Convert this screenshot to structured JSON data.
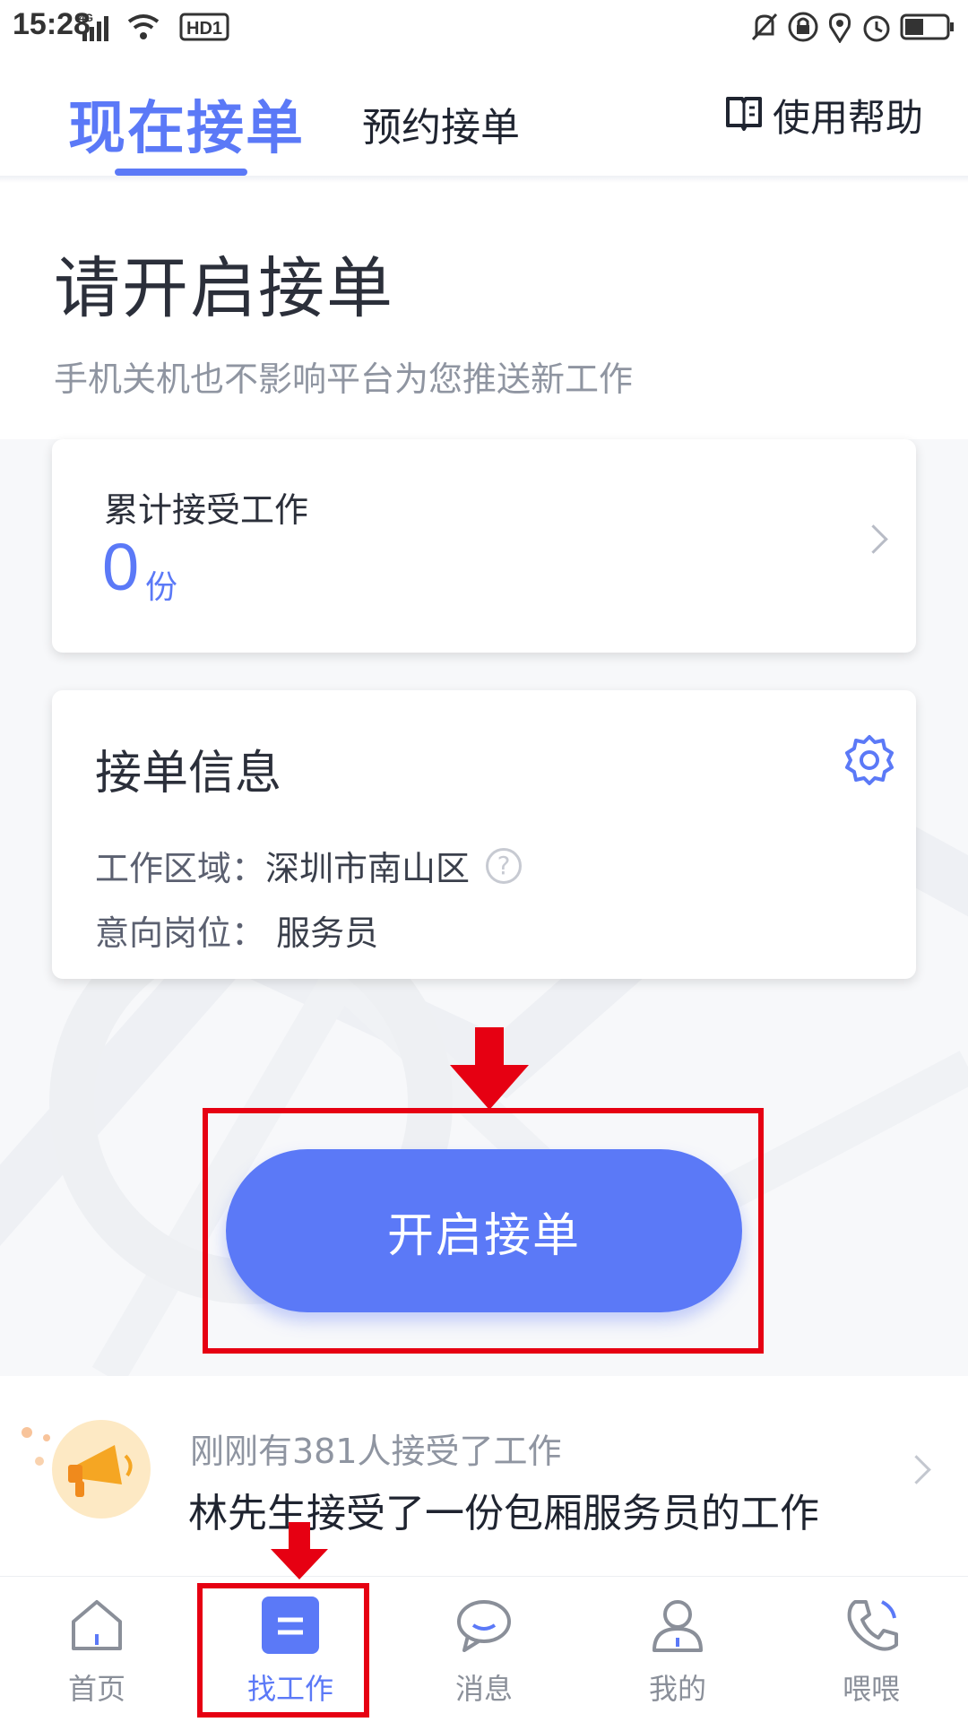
{
  "status_bar": {
    "time": "15:28",
    "network": "4G",
    "hd": "HD1",
    "icons": [
      "signal-icon",
      "wifi-icon",
      "hd-icon",
      "mute-icon",
      "lock-rotation-icon",
      "location-icon",
      "alarm-icon",
      "battery-icon"
    ],
    "battery_level": 0.45
  },
  "tabs": {
    "now": "现在接单",
    "book": "预约接单",
    "help": "使用帮助"
  },
  "main": {
    "heading": "请开启接单",
    "subheading": "手机关机也不影响平台为您推送新工作"
  },
  "accepted_card": {
    "label": "累计接受工作",
    "count": "0",
    "unit": "份"
  },
  "info_card": {
    "title": "接单信息",
    "area_label": "工作区域：",
    "area_value": "深圳市南山区",
    "position_label": "意向岗位：",
    "position_value": "服务员",
    "help_mark": "?"
  },
  "cta": {
    "label": "开启接单"
  },
  "notice": {
    "line1": "刚刚有381人接受了工作",
    "line2": "林先生接受了一份包厢服务员的工作"
  },
  "bottom_nav": {
    "items": [
      {
        "label": "首页",
        "icon": "home-icon"
      },
      {
        "label": "找工作",
        "icon": "job-icon"
      },
      {
        "label": "消息",
        "icon": "message-icon"
      },
      {
        "label": "我的",
        "icon": "profile-icon"
      },
      {
        "label": "喂喂",
        "icon": "phone-icon"
      }
    ],
    "active_index": 1
  },
  "colors": {
    "accent": "#5b79f7",
    "annotation_red": "#e60012"
  }
}
